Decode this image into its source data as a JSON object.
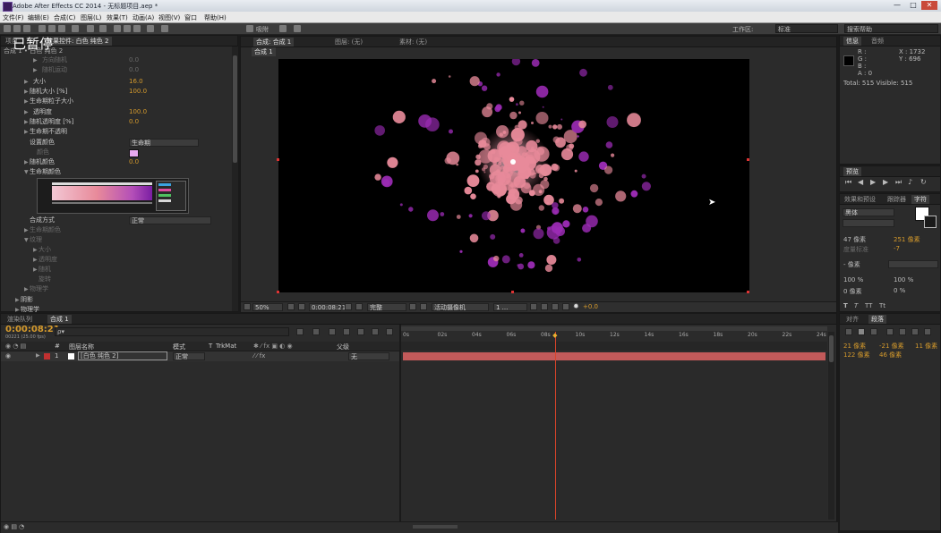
{
  "window": {
    "title": "Adobe After Effects CC 2014 - 无标题项目.aep *",
    "controls": [
      "—",
      "□",
      "✕"
    ]
  },
  "menu": [
    "文件(F)",
    "编辑(E)",
    "合成(C)",
    "图层(L)",
    "效果(T)",
    "动画(A)",
    "视图(V)",
    "窗口",
    "帮助(H)"
  ],
  "toolbar": {
    "snap_label": "吸附",
    "workspace_label": "工作区:",
    "workspace_value": "标准",
    "search_placeholder": "搜索帮助"
  },
  "watermark": "已暂停",
  "effects_panel": {
    "tab_label": "效果控件: 白色 纯色 2",
    "breadcrumb": "合成 1 • 白色 纯色 2",
    "rows": [
      {
        "label": "方向随机",
        "value": "0.0",
        "dim": true
      },
      {
        "label": "随机运动",
        "value": "0.0",
        "dim": true
      },
      {
        "label": "大小",
        "value": "16.0",
        "dim": false
      },
      {
        "label": "随机大小 [%]",
        "value": "100.0",
        "dim": false
      },
      {
        "label": "生命期粒子大小",
        "value": "",
        "dim": false
      },
      {
        "label": "透明度",
        "value": "100.0",
        "dim": false
      },
      {
        "label": "随机透明度 [%]",
        "value": "0.0",
        "dim": false
      },
      {
        "label": "生命期不透明",
        "value": "",
        "dim": false
      },
      {
        "label": "设置颜色",
        "value": "",
        "dim": false
      },
      {
        "label": "颜色",
        "value": "",
        "dim": true
      },
      {
        "label": "随机颜色",
        "value": "0.0",
        "dim": false
      },
      {
        "label": "生命期颜色",
        "value": "",
        "dim": false
      }
    ],
    "set_color_value": "生命期",
    "blend_mode_label": "合成方式",
    "blend_mode_value": "正常",
    "more_rows": [
      {
        "label": "生命期颜色",
        "dim": true
      },
      {
        "label": "纹理",
        "dim": true
      },
      {
        "label": "大小",
        "dim": true
      },
      {
        "label": "透明度",
        "dim": true
      },
      {
        "label": "随机",
        "dim": true
      },
      {
        "label": "旋转",
        "dim": true
      },
      {
        "label": "物理学",
        "dim": false
      }
    ],
    "bottom_items": [
      "阴影",
      "物理学"
    ]
  },
  "comp_panel": {
    "tabs": [
      "合成: 合成 1",
      "图层: (无)",
      "素材: (无)"
    ],
    "sub_tab": "合成 1",
    "zoom": "50%",
    "timecode": "0:00:08:21",
    "quality": "完整",
    "camera": "活动摄像机",
    "views": "1 ...",
    "exposure": "+0.0"
  },
  "info_panel": {
    "tabs": [
      "信息",
      "音频"
    ],
    "r": "R :",
    "g": "G :",
    "b": "B :",
    "a": "A : 0",
    "x": "X : 1732",
    "y": "Y : 696",
    "total": "Total: 515  Visible: 515"
  },
  "preview_panel": {
    "tab": "预览"
  },
  "char_panel": {
    "tabs": [
      "效果和预设",
      "跟踪器",
      "字符"
    ],
    "font": "黑体",
    "font_style": "",
    "size": "47 像素",
    "leading": "251 像素",
    "kerning": "度量标准",
    "tracking": "-7",
    "stroke": "- 像素",
    "v_scale": "100 %",
    "h_scale": "100 %",
    "baseline": "0 像素",
    "tsume": "0 %"
  },
  "para_panel": {
    "tabs": [
      "对齐",
      "段落"
    ],
    "indent1": "21 像素",
    "indent2": "-21 像素",
    "indent3": "11 像素",
    "space1": "122 像素",
    "space2": "46 像素"
  },
  "timeline": {
    "tabs": [
      "渲染队列",
      "合成 1"
    ],
    "timecode": "0:00:08:21",
    "fps": "00221 (25.00 fps)",
    "search_placeholder": "ρ▾",
    "columns": [
      "#",
      "图层名称",
      "模式",
      "T",
      "TrkMat",
      "父级"
    ],
    "layer": {
      "index": "1",
      "name": "[白色 纯色 2]",
      "mode": "正常",
      "parent": "无"
    },
    "ruler_labels": [
      "0s",
      "02s",
      "04s",
      "06s",
      "08s",
      "10s",
      "12s",
      "14s",
      "16s",
      "18s",
      "20s",
      "22s",
      "24s"
    ],
    "playhead_seconds": 8.84
  },
  "colors": {
    "accent_orange": "#d59a2c",
    "layer_bar": "#c25a5a",
    "playhead": "#d8442a",
    "particle_pink": "#e88a9a",
    "particle_purple": "#9b2bb4"
  }
}
